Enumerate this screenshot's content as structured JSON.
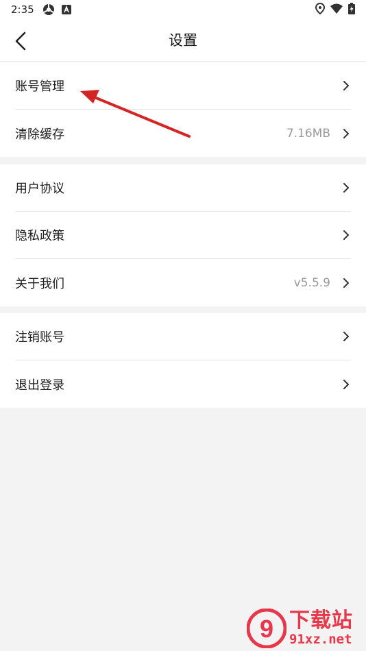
{
  "status_bar": {
    "time": "2:35",
    "icons_left": [
      "sync-icon",
      "a-badge-icon"
    ],
    "icons_right": [
      "location-icon",
      "wifi-icon",
      "battery-charging-icon"
    ]
  },
  "header": {
    "title": "设置",
    "back_icon": "chevron-left-icon"
  },
  "groups": [
    {
      "items": [
        {
          "label": "账号管理",
          "value": ""
        },
        {
          "label": "清除缓存",
          "value": "7.16MB"
        }
      ]
    },
    {
      "items": [
        {
          "label": "用户协议",
          "value": ""
        },
        {
          "label": "隐私政策",
          "value": ""
        },
        {
          "label": "关于我们",
          "value": "v5.5.9"
        }
      ]
    },
    {
      "items": [
        {
          "label": "注销账号",
          "value": ""
        },
        {
          "label": "退出登录",
          "value": ""
        }
      ]
    }
  ],
  "annotation": {
    "type": "red-arrow",
    "color": "#d42525",
    "points_to": "账号管理"
  },
  "watermark": {
    "logo_text": "9",
    "text_cn": "下载站",
    "text_url": "91xz.net",
    "color": "#e8374a"
  },
  "colors": {
    "background": "#f3f3f3",
    "card": "#ffffff",
    "divider": "#e6e6e6",
    "secondary_text": "#9a9a9a"
  }
}
